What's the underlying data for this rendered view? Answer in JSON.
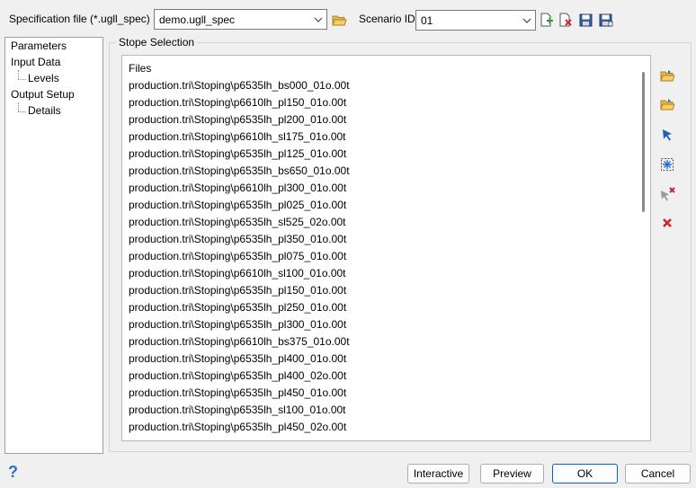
{
  "spec": {
    "label": "Specification file (*.ugll_spec)",
    "value": "demo.ugll_spec"
  },
  "scenario": {
    "label": "Scenario ID",
    "value": "01"
  },
  "tree": {
    "items": [
      "Parameters",
      "Input Data",
      "Levels",
      "Output Setup",
      "Details"
    ]
  },
  "stope": {
    "title": "Stope Selection",
    "column_header": "Files",
    "files": [
      "production.tri\\Stoping\\p6535lh_bs000_01o.00t",
      "production.tri\\Stoping\\p6610lh_pl150_01o.00t",
      "production.tri\\Stoping\\p6535lh_pl200_01o.00t",
      "production.tri\\Stoping\\p6610lh_sl175_01o.00t",
      "production.tri\\Stoping\\p6535lh_pl125_01o.00t",
      "production.tri\\Stoping\\p6535lh_bs650_01o.00t",
      "production.tri\\Stoping\\p6610lh_pl300_01o.00t",
      "production.tri\\Stoping\\p6535lh_pl025_01o.00t",
      "production.tri\\Stoping\\p6535lh_sl525_02o.00t",
      "production.tri\\Stoping\\p6535lh_pl350_01o.00t",
      "production.tri\\Stoping\\p6535lh_pl075_01o.00t",
      "production.tri\\Stoping\\p6610lh_sl100_01o.00t",
      "production.tri\\Stoping\\p6535lh_pl150_01o.00t",
      "production.tri\\Stoping\\p6535lh_pl250_01o.00t",
      "production.tri\\Stoping\\p6535lh_pl300_01o.00t",
      "production.tri\\Stoping\\p6610lh_bs375_01o.00t",
      "production.tri\\Stoping\\p6535lh_pl400_01o.00t",
      "production.tri\\Stoping\\p6535lh_pl400_02o.00t",
      "production.tri\\Stoping\\p6535lh_pl450_01o.00t",
      "production.tri\\Stoping\\p6535lh_sl100_01o.00t",
      "production.tri\\Stoping\\p6535lh_pl450_02o.00t"
    ]
  },
  "buttons": {
    "interactive": "Interactive",
    "preview": "Preview",
    "ok": "OK",
    "cancel": "Cancel"
  },
  "help": {
    "label": "?"
  },
  "colors": {
    "folder": "#e8b848",
    "accent": "#0b5fc5",
    "green": "#2e9a3a",
    "red": "#c8262c",
    "help": "#2a6fcf"
  },
  "icons": {
    "open_file": "folder-open-icon",
    "scenario_new": "new-scenario-icon",
    "scenario_delete": "delete-scenario-icon",
    "save": "save-icon",
    "save_as": "save-as-icon",
    "add_file": "add-file-folder-icon",
    "add_folder": "add-folder-icon",
    "select": "select-pointer-icon",
    "select_box": "select-box-icon",
    "deselect": "deselect-pointer-icon",
    "remove": "remove-icon"
  }
}
